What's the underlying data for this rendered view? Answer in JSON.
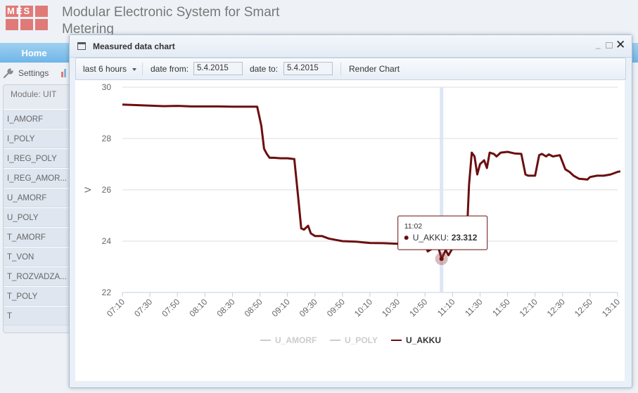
{
  "app": {
    "logo_text": "MES",
    "title": "Modular Electronic System for Smart Metering"
  },
  "nav": {
    "home_label": "Home"
  },
  "toolbar": {
    "settings_label": "Settings"
  },
  "sidebar": {
    "module_label": "Module: UIT",
    "items": [
      "I_AMORF",
      "I_POLY",
      "I_REG_POLY",
      "I_REG_AMOR...",
      "U_AMORF",
      "U_POLY",
      "T_AMORF",
      "T_VON",
      "T_ROZVADZA...",
      "T_POLY",
      "T"
    ]
  },
  "dialog": {
    "title": "Measured data chart",
    "range_label": "last 6 hours",
    "date_from_label": "date from:",
    "date_from_value": "5.4.2015",
    "date_to_label": "date to:",
    "date_to_value": "5.4.2015",
    "render_label": "Render Chart"
  },
  "colors": {
    "series_active": "#6b0f0f",
    "series_inactive": "#cccccc",
    "accent": "#6fb6e8"
  },
  "chart_data": {
    "type": "line",
    "ylabel": "V",
    "ylim": [
      22,
      30
    ],
    "y_ticks": [
      "22",
      "24",
      "26",
      "28",
      "30"
    ],
    "x_ticks": [
      "07:10",
      "07:30",
      "07:50",
      "08:10",
      "08:30",
      "08:50",
      "09:10",
      "09:30",
      "09:50",
      "10:10",
      "10:30",
      "10:50",
      "11:10",
      "11:30",
      "11:50",
      "12:10",
      "12:30",
      "12:50",
      "13:10"
    ],
    "grid": "horizontal",
    "legend_position": "bottom",
    "series": [
      {
        "name": "U_AMORF",
        "visible": false,
        "points": []
      },
      {
        "name": "U_POLY",
        "visible": false,
        "points": []
      },
      {
        "name": "U_AKKU",
        "visible": true,
        "points": [
          [
            "07:10",
            29.32
          ],
          [
            "07:20",
            29.3
          ],
          [
            "07:30",
            29.28
          ],
          [
            "07:40",
            29.26
          ],
          [
            "07:50",
            29.27
          ],
          [
            "08:00",
            29.25
          ],
          [
            "08:10",
            29.25
          ],
          [
            "08:20",
            29.25
          ],
          [
            "08:30",
            29.24
          ],
          [
            "08:40",
            29.24
          ],
          [
            "08:48",
            29.24
          ],
          [
            "08:51",
            28.5
          ],
          [
            "08:53",
            27.6
          ],
          [
            "08:55",
            27.4
          ],
          [
            "08:57",
            27.25
          ],
          [
            "09:00",
            27.25
          ],
          [
            "09:05",
            27.23
          ],
          [
            "09:10",
            27.23
          ],
          [
            "09:15",
            27.2
          ],
          [
            "09:18",
            25.6
          ],
          [
            "09:20",
            24.5
          ],
          [
            "09:22",
            24.45
          ],
          [
            "09:25",
            24.6
          ],
          [
            "09:27",
            24.3
          ],
          [
            "09:30",
            24.2
          ],
          [
            "09:35",
            24.2
          ],
          [
            "09:40",
            24.1
          ],
          [
            "09:45",
            24.05
          ],
          [
            "09:50",
            24.0
          ],
          [
            "10:00",
            23.98
          ],
          [
            "10:05",
            23.95
          ],
          [
            "10:10",
            23.93
          ],
          [
            "10:20",
            23.92
          ],
          [
            "10:30",
            23.9
          ],
          [
            "10:40",
            23.92
          ],
          [
            "10:45",
            23.88
          ],
          [
            "10:50",
            23.9
          ],
          [
            "10:52",
            23.6
          ],
          [
            "10:55",
            23.7
          ],
          [
            "10:58",
            23.9
          ],
          [
            "11:00",
            23.7
          ],
          [
            "11:02",
            23.31
          ],
          [
            "11:05",
            23.65
          ],
          [
            "11:07",
            23.45
          ],
          [
            "11:10",
            23.72
          ],
          [
            "11:15",
            23.7
          ],
          [
            "11:20",
            23.72
          ],
          [
            "11:22",
            26.2
          ],
          [
            "11:24",
            27.45
          ],
          [
            "11:26",
            27.3
          ],
          [
            "11:28",
            26.6
          ],
          [
            "11:30",
            27.0
          ],
          [
            "11:33",
            27.15
          ],
          [
            "11:35",
            26.85
          ],
          [
            "11:37",
            27.45
          ],
          [
            "11:40",
            27.4
          ],
          [
            "11:42",
            27.3
          ],
          [
            "11:45",
            27.45
          ],
          [
            "11:50",
            27.48
          ],
          [
            "11:55",
            27.42
          ],
          [
            "12:00",
            27.4
          ],
          [
            "12:03",
            26.6
          ],
          [
            "12:05",
            26.55
          ],
          [
            "12:10",
            26.55
          ],
          [
            "12:13",
            27.35
          ],
          [
            "12:15",
            27.4
          ],
          [
            "12:18",
            27.3
          ],
          [
            "12:20",
            27.38
          ],
          [
            "12:23",
            27.3
          ],
          [
            "12:28",
            27.35
          ],
          [
            "12:32",
            26.8
          ],
          [
            "12:35",
            26.7
          ],
          [
            "12:38",
            26.55
          ],
          [
            "12:42",
            26.43
          ],
          [
            "12:45",
            26.42
          ],
          [
            "12:48",
            26.4
          ],
          [
            "12:50",
            26.5
          ],
          [
            "12:55",
            26.55
          ],
          [
            "13:00",
            26.55
          ],
          [
            "13:05",
            26.6
          ],
          [
            "13:10",
            26.7
          ],
          [
            "13:12",
            26.72
          ]
        ]
      }
    ],
    "tooltip": {
      "time": "11:02",
      "series": "U_AKKU",
      "value": "23.312",
      "x": "11:02",
      "y": 23.312
    }
  }
}
